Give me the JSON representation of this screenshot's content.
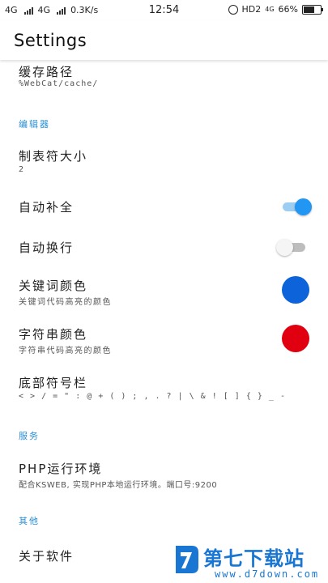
{
  "status_bar": {
    "net1": "4G",
    "net2": "4G",
    "speed": "0.3K/s",
    "time": "12:54",
    "hd": "HD2",
    "net3": "4G",
    "battery": "66%",
    "battery_level": 0.66
  },
  "app_bar": {
    "title": "Settings"
  },
  "items": {
    "cache_path": {
      "title": "缓存路径",
      "summary": "%WebCat/cache/"
    },
    "cat_editor": "编辑器",
    "tab_size": {
      "title": "制表符大小",
      "summary": "2"
    },
    "auto_complete": {
      "title": "自动补全",
      "on": true
    },
    "word_wrap": {
      "title": "自动换行",
      "on": false
    },
    "keyword_color": {
      "title": "关键词颜色",
      "summary": "关键词代码高亮的颜色",
      "color": "#0d63d9"
    },
    "string_color": {
      "title": "字符串颜色",
      "summary": "字符串代码高亮的颜色",
      "color": "#e0000f"
    },
    "bottom_symbols": {
      "title": "底部符号栏",
      "summary": "< > / = \" : @ + ( ) ; , . ? | \\ & ! [ ] { } _ -"
    },
    "cat_service": "服务",
    "php_env": {
      "title": "PHP运行环境",
      "summary": "配合KSWEB, 实现PHP本地运行环境。端口号:9200"
    },
    "cat_other": "其他",
    "about": {
      "title": "关于软件"
    }
  },
  "watermark": {
    "title": "第七下载站",
    "url": "www.d7down.com"
  },
  "colors": {
    "accent": "#2196f3",
    "category": "#2a8fd6"
  }
}
